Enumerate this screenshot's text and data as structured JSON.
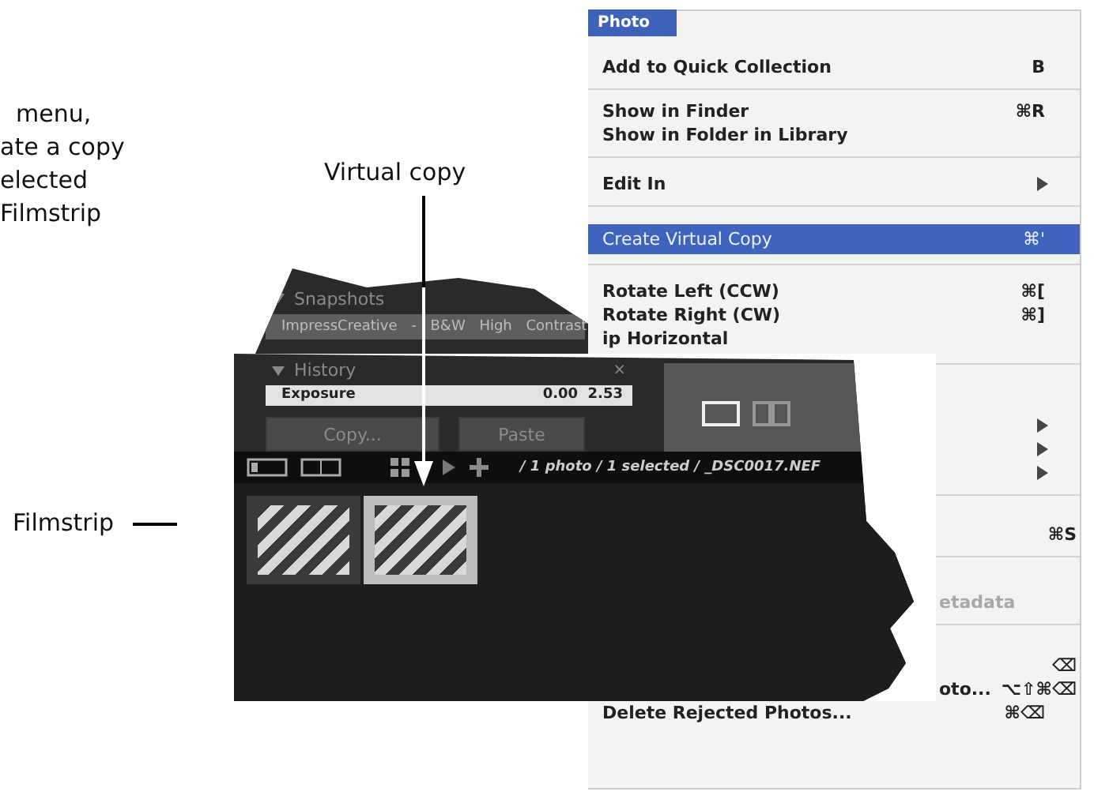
{
  "caption": {
    "lines": [
      "menu,",
      "ate a copy",
      "elected",
      "Filmstrip"
    ]
  },
  "callouts": [
    {
      "kind": "arrow",
      "label": "Virtual copy"
    },
    {
      "kind": "leader",
      "label": "Filmstrip"
    }
  ],
  "menu": {
    "title": "Photo",
    "items": [
      {
        "kind": "item",
        "label": "Add to Quick Collection",
        "shortcut": "B",
        "selected": false,
        "submenu": false,
        "disabled": false
      },
      {
        "kind": "separator"
      },
      {
        "kind": "item",
        "label": "Show in Finder",
        "shortcut": "⌘R",
        "selected": false,
        "submenu": false,
        "disabled": false
      },
      {
        "kind": "item",
        "label": "Show in Folder in Library",
        "selected": false,
        "submenu": false,
        "disabled": false
      },
      {
        "kind": "separator"
      },
      {
        "kind": "item",
        "label": "Edit In",
        "selected": false,
        "submenu": true,
        "disabled": false
      },
      {
        "kind": "separator"
      },
      {
        "kind": "item",
        "label": "Create Virtual Copy",
        "shortcut": "⌘'",
        "selected": true,
        "submenu": false,
        "disabled": false
      },
      {
        "kind": "separator"
      },
      {
        "kind": "item",
        "label": "Rotate Left (CCW)",
        "shortcut": "⌘[",
        "selected": false,
        "submenu": false,
        "disabled": false
      },
      {
        "kind": "item",
        "label": "Rotate Right (CW)",
        "shortcut": "⌘]",
        "selected": false,
        "submenu": false,
        "disabled": false
      },
      {
        "kind": "item",
        "label": "ip Horizontal",
        "selected": false,
        "submenu": false,
        "disabled": false
      },
      {
        "kind": "separator"
      },
      {
        "kind": "item",
        "selected": false,
        "submenu": true
      },
      {
        "kind": "item",
        "selected": false,
        "submenu": true
      },
      {
        "kind": "item",
        "selected": false,
        "submenu": true
      },
      {
        "kind": "separator"
      },
      {
        "kind": "item",
        "shortcut": "⌘S",
        "selected": false,
        "submenu": false,
        "disabled": false
      },
      {
        "kind": "separator"
      },
      {
        "kind": "item",
        "label": "etadata",
        "selected": false,
        "submenu": false,
        "disabled": true
      },
      {
        "kind": "separator"
      },
      {
        "kind": "item",
        "shortcut": "⌫",
        "selected": false,
        "submenu": false,
        "disabled": false
      },
      {
        "kind": "item",
        "label": "oto...",
        "shortcut": "⌥⇧⌘⌫",
        "selected": false,
        "submenu": false,
        "disabled": false
      },
      {
        "kind": "item",
        "label": "Delete Rejected Photos...",
        "shortcut": "⌘⌫",
        "selected": false,
        "submenu": false,
        "disabled": false
      }
    ]
  },
  "panel": {
    "snapshots": {
      "title": "Snapshots",
      "expanded": true,
      "items": [
        "ImpressCreative - B&W High Contrast"
      ]
    },
    "history": {
      "title": "History",
      "expanded": true,
      "close": "×",
      "rows": [
        {
          "step": "Exposure",
          "from": "0.00",
          "to": "2.53"
        }
      ]
    },
    "buttons": [
      "Copy...",
      "Paste"
    ],
    "view_modes": [
      {
        "selected": true
      },
      {
        "selected": false
      }
    ],
    "path": "/ 1 photo / 1 selected / _DSC0017.NEF",
    "filmstrip": [
      {
        "selected": false
      },
      {
        "selected": true
      }
    ]
  }
}
